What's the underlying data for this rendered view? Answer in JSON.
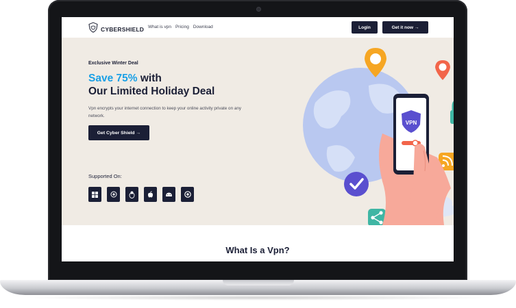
{
  "header": {
    "brand": "CYBERSHIELD",
    "nav": [
      "What is vpn",
      "Pricing",
      "Download"
    ],
    "login_label": "Login",
    "get_now_label": "Get it now →"
  },
  "hero": {
    "eyebrow": "Exclusive Winter Deal",
    "headline_accent": "Save 75%",
    "headline_rest1": " with",
    "headline_line2": "Our Limited Holiday Deal",
    "description": "Vpn encrypts your internet connection to keep your online activity private on any network.",
    "cta_label": "Get Cyber Shield →",
    "supported_label": "Supported On:",
    "platforms": [
      "windows-icon",
      "linux-icon",
      "penguin-icon",
      "apple-icon",
      "android-icon",
      "chrome-icon"
    ],
    "phone_badge": "VPN"
  },
  "section": {
    "title": "What Is a Vpn?"
  },
  "colors": {
    "dark": "#1b1f36",
    "accent": "#1aa0e6",
    "hero_bg": "#f0ebe4"
  }
}
